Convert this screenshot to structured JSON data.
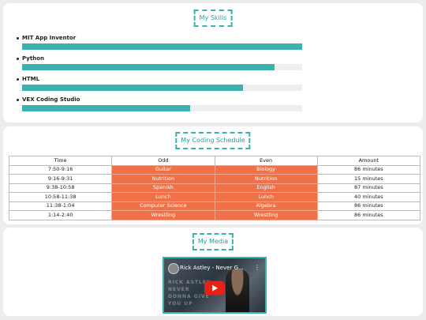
{
  "skills": {
    "title": "My Skills",
    "items": [
      {
        "label": "MIT App Inventor",
        "level": 100
      },
      {
        "label": "Python",
        "level": 90
      },
      {
        "label": "HTML",
        "level": 79
      },
      {
        "label": "VEX Coding Studio",
        "level": 60
      }
    ]
  },
  "schedule": {
    "title": "My Coding Schedule",
    "headers": [
      "Time",
      "Odd",
      "Even",
      "Amount"
    ],
    "rows": [
      [
        "7:50-9:16",
        "Guitar",
        "Biology",
        "86 minutes"
      ],
      [
        "9:16-9:31",
        "Nutrition",
        "Nutrition",
        "15 minutes"
      ],
      [
        "9:38-10:58",
        "Spanish",
        "English",
        "87 minutes"
      ],
      [
        "10:58-11:38",
        "Lunch",
        "Lunch",
        "40 minutes"
      ],
      [
        "11:38-1:04",
        "Computer Science",
        "Algebra",
        "86 minutes"
      ],
      [
        "1:14-2:40",
        "Wrestling",
        "Wrestling",
        "86 minutes"
      ]
    ],
    "colors": {
      "activity_bg": "#f07148"
    }
  },
  "media": {
    "title": "My Media",
    "video_title": "Rick Astley - Never G...",
    "thumbnail_text": "RICK ASTLEY NEVER GONNA GIVE YOU UP",
    "icons": [
      "avatar",
      "menu-dots-icon",
      "play-icon"
    ]
  },
  "colors": {
    "accent": "#3ab3b0",
    "background": "#ececec"
  }
}
